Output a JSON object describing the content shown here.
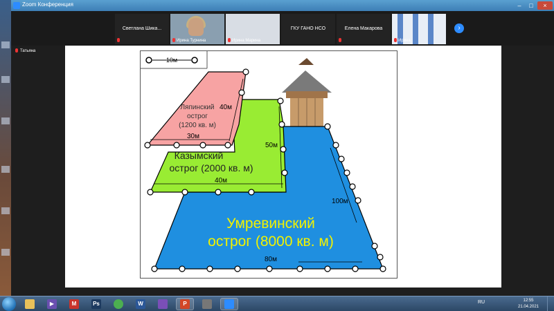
{
  "window": {
    "title": "Zoom Конференция",
    "controls": {
      "minimize": "–",
      "maximize": "□",
      "close": "×"
    }
  },
  "gallery": {
    "tiles": [
      {
        "name": "Светлана  Шика...",
        "kind": "name"
      },
      {
        "name": "Ирина Турнина",
        "kind": "video"
      },
      {
        "name": "Ирина Марина",
        "kind": "video2"
      },
      {
        "name": "ГКУ ГАНО НСО",
        "kind": "name"
      },
      {
        "name": "Елена Макарова",
        "kind": "name"
      },
      {
        "name": "Ирина",
        "kind": "video3"
      }
    ],
    "next_icon": "chevron-right-icon",
    "next_glyph": "›"
  },
  "speaker": {
    "label": "Татьяна"
  },
  "slide": {
    "scale": "10м",
    "forts": [
      {
        "name_line1": "Ляпинский",
        "name_line2": "острог",
        "area": "(1200 кв. м)",
        "width": "30м",
        "height": "40м",
        "color": "#f7a3a3"
      },
      {
        "name_line1": "Казымский",
        "name_line2": "острог (2000 кв. м)",
        "width": "40м",
        "height": "50м",
        "color": "#99ec33"
      },
      {
        "name_line1": "Умревинский",
        "name_line2": "острог (8000 кв. м)",
        "width": "80м",
        "height": "100м",
        "color": "#1f8fe0",
        "text_color": "#f2f200"
      }
    ]
  },
  "taskbar": {
    "apps": [
      {
        "name": "explorer",
        "glyph": "",
        "color": "#e8c15a"
      },
      {
        "name": "media",
        "glyph": "▶",
        "color": "#6a4fb0"
      },
      {
        "name": "mail",
        "glyph": "M",
        "color": "#c8332b"
      },
      {
        "name": "photoshop",
        "glyph": "Ps",
        "color": "#1d3a5f"
      },
      {
        "name": "chrome",
        "glyph": "",
        "color": "#4caf50"
      },
      {
        "name": "word",
        "glyph": "W",
        "color": "#2b5797"
      },
      {
        "name": "tool",
        "glyph": "",
        "color": "#7a4fb8"
      },
      {
        "name": "powerpoint",
        "glyph": "P",
        "color": "#d24726"
      },
      {
        "name": "mic",
        "glyph": "",
        "color": "#777777"
      },
      {
        "name": "zoom",
        "glyph": "",
        "color": "#2d8cff"
      }
    ],
    "tray_lang": "RU",
    "clock_time": "12:55",
    "clock_date": "21.04.2021"
  }
}
